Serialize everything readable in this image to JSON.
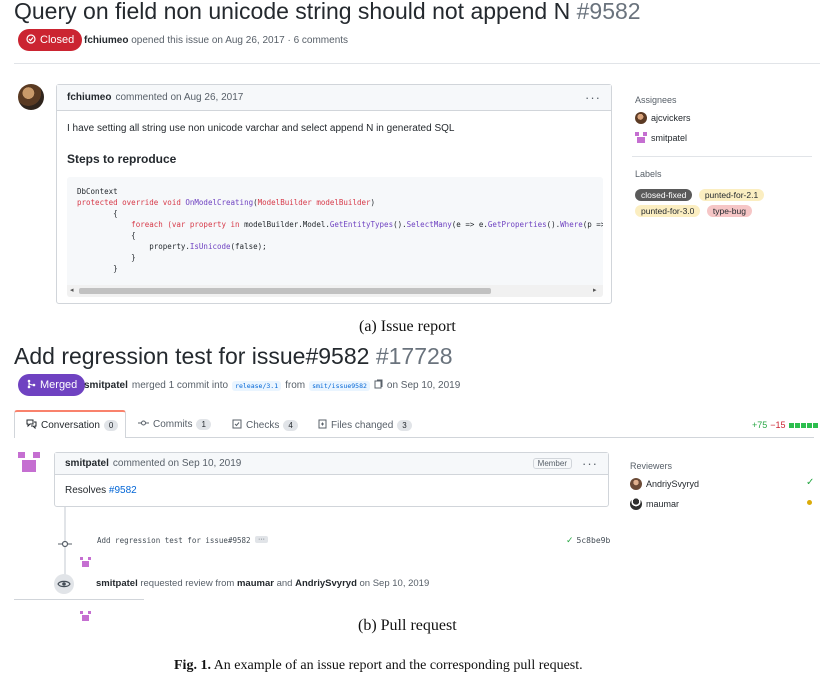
{
  "issue": {
    "title": "Query on field non unicode string should not append N",
    "number": "#9582",
    "state": "Closed",
    "author": "fchiumeo",
    "meta_rest": "opened this issue on Aug 26, 2017 · 6 comments",
    "comment": {
      "author": "fchiumeo",
      "action": "commented on Aug 26, 2017",
      "menu": "···",
      "body": "I have setting all string use non unicode varchar and select append N in generated SQL",
      "heading": "Steps to reproduce",
      "code": {
        "l1": "DbContext",
        "l2a": "protected override void ",
        "l2b": "OnModelCreating",
        "l2c": "(",
        "l2d": "ModelBuilder modelBuilder",
        "l2e": ")",
        "l3": "        {",
        "l4a": "            foreach ",
        "l4b": "(var property in ",
        "l4c": "modelBuilder.Model.",
        "l4d": "GetEntityTypes",
        "l4e": "().",
        "l4f": "SelectMany",
        "l4g": "(e => e.",
        "l4h": "GetProperties",
        "l4i": "().",
        "l4j": "Where",
        "l4k": "(p => p.C",
        "l5": "            {",
        "l6a": "                property.",
        "l6b": "IsUnicode",
        "l6c": "(false);",
        "l7": "            }",
        "l8": "        }"
      }
    },
    "sidebar": {
      "assignees_title": "Assignees",
      "assignees": [
        "ajcvickers",
        "smitpatel"
      ],
      "labels_title": "Labels",
      "labels": [
        {
          "text": "closed-fixed",
          "bg": "#5a5a5a",
          "fg": "#ffffff"
        },
        {
          "text": "punted-for-2.1",
          "bg": "#fbeec1",
          "fg": "#24292e"
        },
        {
          "text": "punted-for-3.0",
          "bg": "#fbeec1",
          "fg": "#24292e"
        },
        {
          "text": "type-bug",
          "bg": "#f6c6c6",
          "fg": "#24292e"
        }
      ]
    },
    "caption": "(a) Issue report"
  },
  "pr": {
    "title": "Add regression test for issue#9582",
    "number": "#17728",
    "state": "Merged",
    "author": "smitpatel",
    "merged_text": "merged 1 commit into",
    "base_branch": "release/3.1",
    "from_text": "from",
    "head_branch": "smit/issue9582",
    "date_text": "on Sep 10, 2019",
    "tabs": [
      {
        "label": "Conversation",
        "count": "0"
      },
      {
        "label": "Commits",
        "count": "1"
      },
      {
        "label": "Checks",
        "count": "4"
      },
      {
        "label": "Files changed",
        "count": "3"
      }
    ],
    "diffstat_add": "+75",
    "diffstat_del": "−15",
    "comment": {
      "author": "smitpatel",
      "action": "commented on Sep 10, 2019",
      "role": "Member",
      "menu": "···",
      "body_prefix": "Resolves ",
      "body_link": "#9582"
    },
    "commit": {
      "message": "Add regression test for issue#9582",
      "ellipsis": "···",
      "sha": "5c8be9b"
    },
    "review_event": {
      "author": "smitpatel",
      "text1": "requested review from",
      "user1": "maumar",
      "text2": "and",
      "user2": "AndriySvyryd",
      "date": "on Sep 10, 2019"
    },
    "sidebar": {
      "reviewers_title": "Reviewers",
      "reviewers": [
        "AndriySvyryd",
        "maumar"
      ]
    },
    "caption": "(b) Pull request"
  },
  "figure": {
    "label": "Fig. 1.",
    "text": "An example of an issue report and the corresponding pull request."
  },
  "colors": {
    "closed": "#cb2431",
    "merged": "#6f42c1",
    "link": "#0366d6",
    "success": "#28a745",
    "pending": "#dbab09"
  }
}
